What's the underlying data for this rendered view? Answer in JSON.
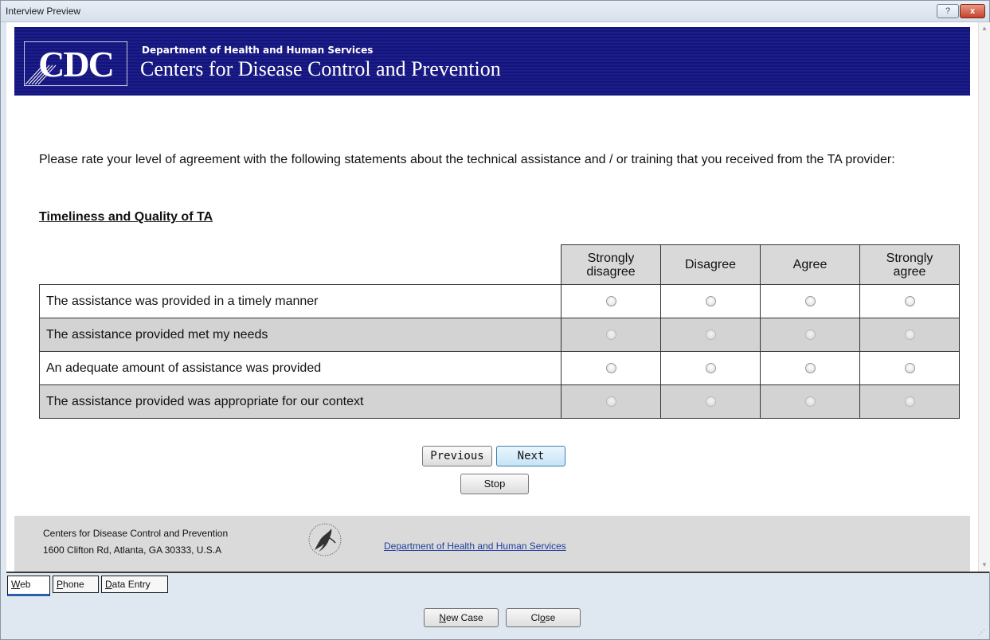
{
  "window": {
    "title": "Interview Preview",
    "help_label": "?",
    "close_label": "x"
  },
  "banner": {
    "logo_text": "CDC",
    "department": "Department of Health and Human Services",
    "agency": "Centers for Disease Control and Prevention"
  },
  "survey": {
    "prompt": "Please rate your level of agreement with the following statements about the technical assistance and / or training that you received from the TA provider:",
    "section_title": "Timeliness and Quality of TA",
    "columns": [
      {
        "line1": "Strongly",
        "line2": "disagree"
      },
      {
        "line1": "Disagree",
        "line2": ""
      },
      {
        "line1": "Agree",
        "line2": ""
      },
      {
        "line1": "Strongly",
        "line2": "agree"
      }
    ],
    "rows": [
      "The assistance was provided in a timely manner",
      "The assistance provided met my needs",
      "An adequate amount of assistance was provided",
      "The assistance provided was appropriate for our context"
    ]
  },
  "nav": {
    "previous": "Previous",
    "next": "Next",
    "stop": "Stop"
  },
  "footer": {
    "org": "Centers for Disease Control and Prevention",
    "address": "1600 Clifton Rd, Atlanta, GA 30333, U.S.A",
    "link": "Department of Health and Human Services"
  },
  "tabs": {
    "web_first": "W",
    "web_rest": "eb",
    "phone_first": "P",
    "phone_rest": "hone",
    "entry_first": "D",
    "entry_rest": "ata Entry"
  },
  "actions": {
    "new_case_first": "N",
    "new_case_rest": "ew Case",
    "close_pre": "Cl",
    "close_u": "o",
    "close_post": "se"
  },
  "colors": {
    "banner": "#14157a",
    "footer": "#dadada",
    "shaded_row": "#d3d3d3",
    "link": "#1f3f9e"
  }
}
